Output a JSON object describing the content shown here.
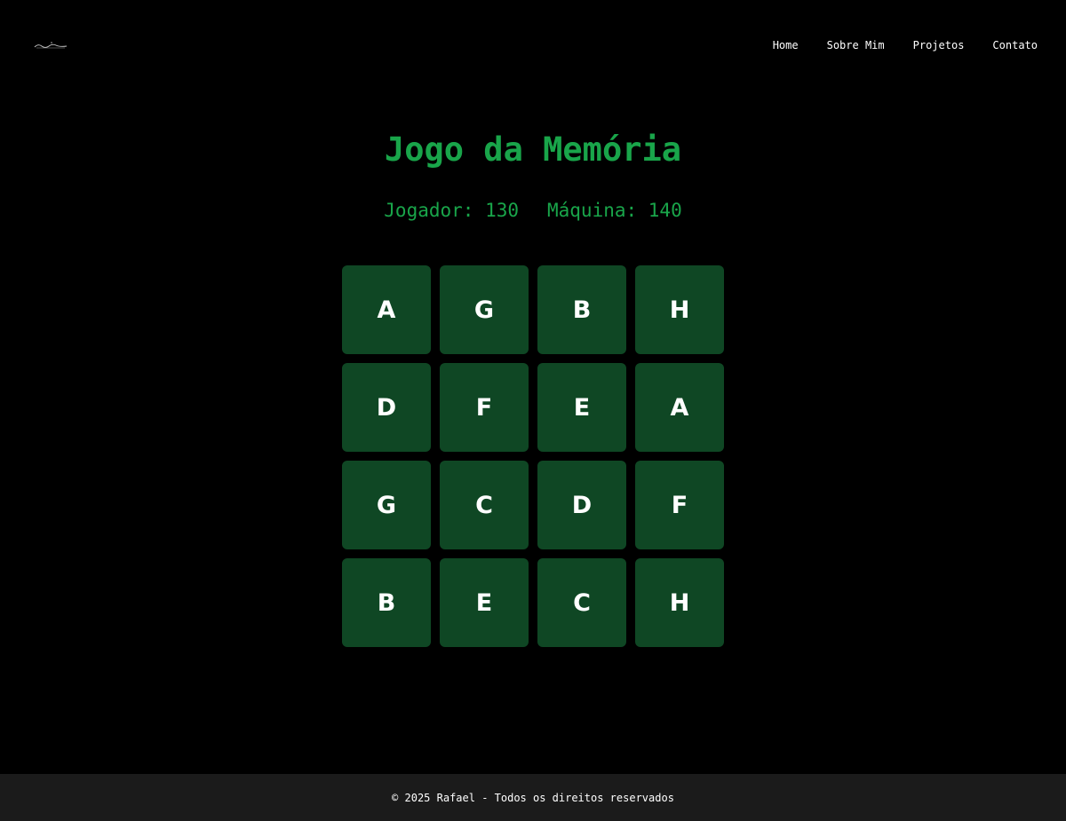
{
  "header": {
    "logo_icon": "signature-logo",
    "nav": [
      {
        "label": "Home"
      },
      {
        "label": "Sobre Mim"
      },
      {
        "label": "Projetos"
      },
      {
        "label": "Contato"
      }
    ]
  },
  "game": {
    "title": "Jogo da Memória",
    "player_score_label": "Jogador: 130",
    "machine_score_label": "Máquina: 140",
    "cards": [
      "A",
      "G",
      "B",
      "H",
      "D",
      "F",
      "E",
      "A",
      "G",
      "C",
      "D",
      "F",
      "B",
      "E",
      "C",
      "H"
    ]
  },
  "footer": {
    "text": "© 2025 Rafael - Todos os direitos reservados"
  },
  "colors": {
    "accent": "#19a54a",
    "card": "#0f4724",
    "background": "#000000",
    "footer_bg": "#1b1b1b"
  }
}
